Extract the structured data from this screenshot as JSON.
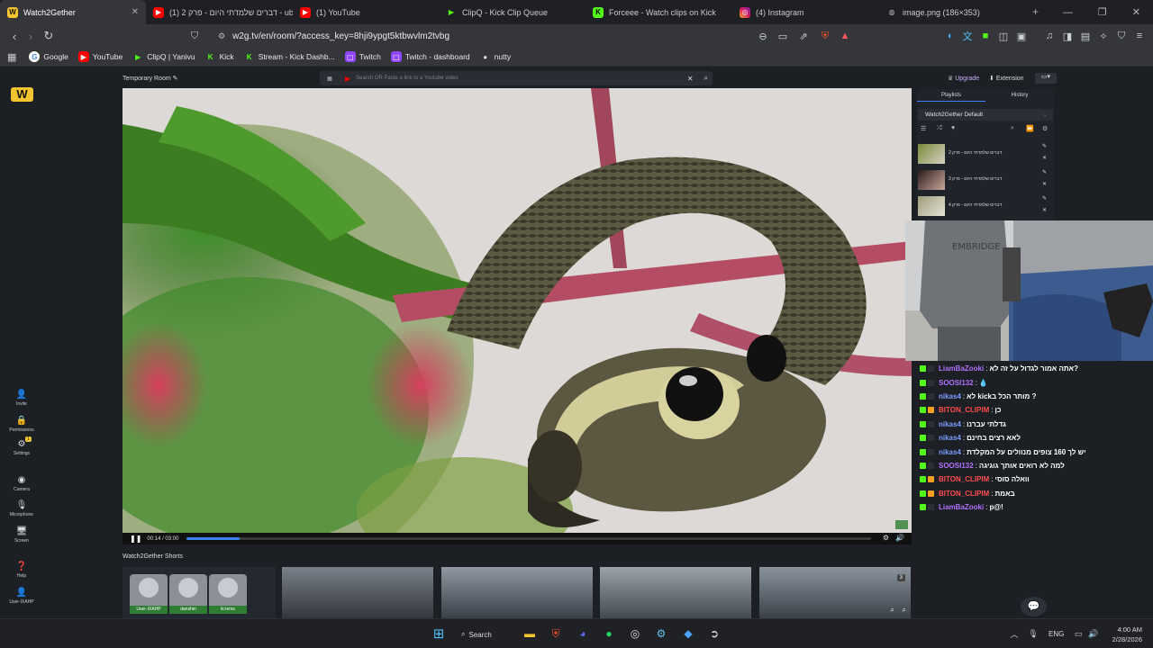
{
  "tabs": [
    {
      "title": "Watch2Gether",
      "icon": "watch2gether-icon",
      "active": true
    },
    {
      "title": "(1) דברים שלמדתי היום - פרק 2 - ube",
      "icon": "youtube-icon"
    },
    {
      "title": "(1) YouTube",
      "icon": "youtube-icon"
    },
    {
      "title": "ClipQ - Kick Clip Queue",
      "icon": "clipq-icon"
    },
    {
      "title": "Forceee - Watch clips on Kick",
      "icon": "kick-icon"
    },
    {
      "title": "(4) Instagram",
      "icon": "instagram-icon"
    },
    {
      "title": "image.png (186×353)",
      "icon": "globe-icon"
    }
  ],
  "url": "w2g.tv/en/room/?access_key=8hji9ypgt5ktbwvlm2tvbg",
  "bookmarks": [
    {
      "label": "Google",
      "icon": "google-icon"
    },
    {
      "label": "YouTube",
      "icon": "youtube-icon"
    },
    {
      "label": "ClipQ | Yanivu",
      "icon": "clipq-icon"
    },
    {
      "label": "Kick",
      "icon": "kick-icon"
    },
    {
      "label": "Stream - Kick Dashb...",
      "icon": "kick-icon"
    },
    {
      "label": "Twitch",
      "icon": "twitch-icon"
    },
    {
      "label": "Twitch - dashboard",
      "icon": "twitch-icon"
    },
    {
      "label": "nutty",
      "icon": "nutty-icon"
    }
  ],
  "room": {
    "title": "Temporary Room",
    "search_placeholder": "Search OR Paste a link to a Youtube video",
    "upgrade": "Upgrade",
    "extension": "Extension"
  },
  "leftnav": {
    "invite": "Invite",
    "permissions": "Permissions",
    "settings": "Settings",
    "settings_badge": "1",
    "camera": "Camera",
    "microphone": "Microphone",
    "screen": "Screen",
    "help": "Help",
    "user": "User-IXAHP"
  },
  "player": {
    "time": "00:14 / 03:00",
    "progress": 0.078
  },
  "playlist": {
    "tab_playlists": "Playlists",
    "tab_history": "History",
    "selected": "Watch2Gether Default",
    "items": [
      {
        "title": "דברים שלמדתי היום - פרק 2"
      },
      {
        "title": "דברים שלמדתי היום - פרק 3"
      },
      {
        "title": "דברים שלמדתי היום - פרק 4"
      }
    ]
  },
  "chat": [
    {
      "user": "LiamBaZooki",
      "color": "#b072ff",
      "text": "אתה אמור לגדול על זה לא?"
    },
    {
      "user": "SOOSI132",
      "color": "#b072ff",
      "text": "💧"
    },
    {
      "user": "nikas4",
      "color": "#7d9cff",
      "text": "לא kickמותר הכל ב ?"
    },
    {
      "user": "BITON_CLIPIM",
      "color": "#ff4d4d",
      "text": "כן"
    },
    {
      "user": "nikas4",
      "color": "#7d9cff",
      "text": "גדלתי עברנו"
    },
    {
      "user": "nikas4",
      "color": "#7d9cff",
      "text": "לאא רצים בחינם"
    },
    {
      "user": "nikas4",
      "color": "#7d9cff",
      "text": "יש לך 160 צופים מנוולים על המקלדת"
    },
    {
      "user": "SOOSI132",
      "color": "#b072ff",
      "text": "למה לא רואים אותך גוגיגה"
    },
    {
      "user": "BITON_CLIPIM",
      "color": "#ff4d4d",
      "text": "וואלה סוסי"
    },
    {
      "user": "BITON_CLIPIM",
      "color": "#ff4d4d",
      "text": "באמת"
    },
    {
      "user": "LiamBaZooki",
      "color": "#b072ff",
      "text": "p@!"
    }
  ],
  "shorts": {
    "heading": "Watch2Gether Shorts",
    "count": "3",
    "users": [
      {
        "name": "User-IXAHP"
      },
      {
        "name": "danshin"
      },
      {
        "name": "licrems"
      }
    ]
  },
  "taskbar": {
    "search": "Search",
    "lang": "ENG",
    "time": "4:00 AM",
    "date": "2/28/2026"
  }
}
